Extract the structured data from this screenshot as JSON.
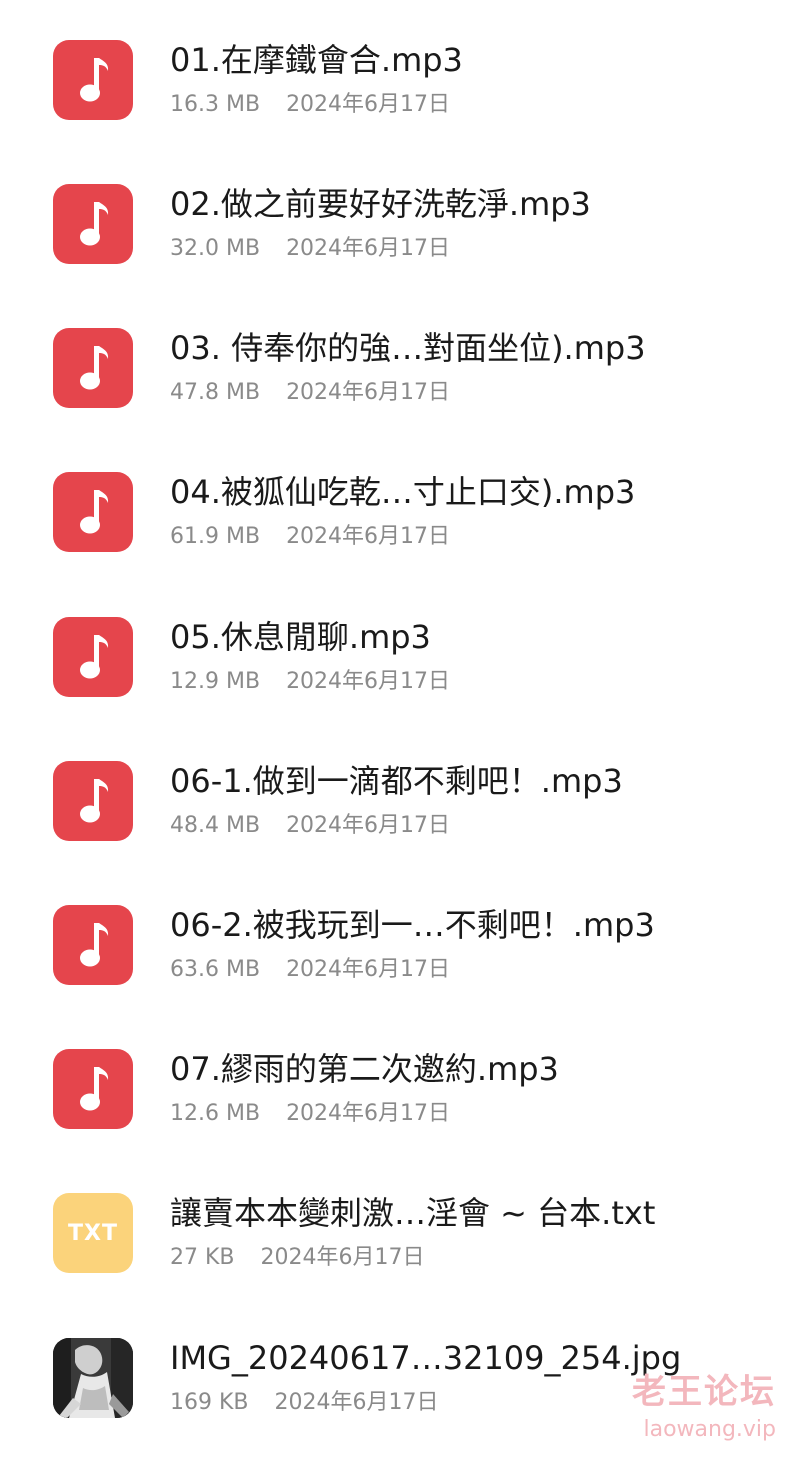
{
  "files": [
    {
      "icon": "music-note-icon",
      "type": "music",
      "name": "01.在摩鐵會合.mp3",
      "size": "16.3 MB",
      "date": "2024年6月17日"
    },
    {
      "icon": "music-note-icon",
      "type": "music",
      "name": "02.做之前要好好洗乾淨.mp3",
      "size": "32.0 MB",
      "date": "2024年6月17日"
    },
    {
      "icon": "music-note-icon",
      "type": "music",
      "name": "03. 侍奉你的強…對面坐位).mp3",
      "size": "47.8 MB",
      "date": "2024年6月17日"
    },
    {
      "icon": "music-note-icon",
      "type": "music",
      "name": "04.被狐仙吃乾…寸止口交).mp3",
      "size": "61.9 MB",
      "date": "2024年6月17日"
    },
    {
      "icon": "music-note-icon",
      "type": "music",
      "name": "05.休息閒聊.mp3",
      "size": "12.9 MB",
      "date": "2024年6月17日"
    },
    {
      "icon": "music-note-icon",
      "type": "music",
      "name": "06-1.做到一滴都不剩吧！.mp3",
      "size": "48.4 MB",
      "date": "2024年6月17日"
    },
    {
      "icon": "music-note-icon",
      "type": "music",
      "name": "06-2.被我玩到一…不剩吧！.mp3",
      "size": "63.6 MB",
      "date": "2024年6月17日"
    },
    {
      "icon": "music-note-icon",
      "type": "music",
      "name": "07.繆雨的第二次邀約.mp3",
      "size": "12.6 MB",
      "date": "2024年6月17日"
    },
    {
      "icon": "txt-file-icon",
      "type": "txt",
      "icon_label": "TXT",
      "name": "讓賣本本變刺激…淫會 ~ 台本.txt",
      "size": "27 KB",
      "date": "2024年6月17日"
    },
    {
      "icon": "image-thumbnail-icon",
      "type": "img",
      "name": "IMG_20240617…32109_254.jpg",
      "size": "169 KB",
      "date": "2024年6月17日"
    }
  ],
  "watermark": {
    "title": "老王论坛",
    "url": "laowang.vip"
  },
  "colors": {
    "music_icon": "#e5454c",
    "txt_icon": "#fbd37b",
    "name_text": "#1a1a1a",
    "meta_text": "#8a8a8a",
    "watermark": "#f3b7bd"
  }
}
